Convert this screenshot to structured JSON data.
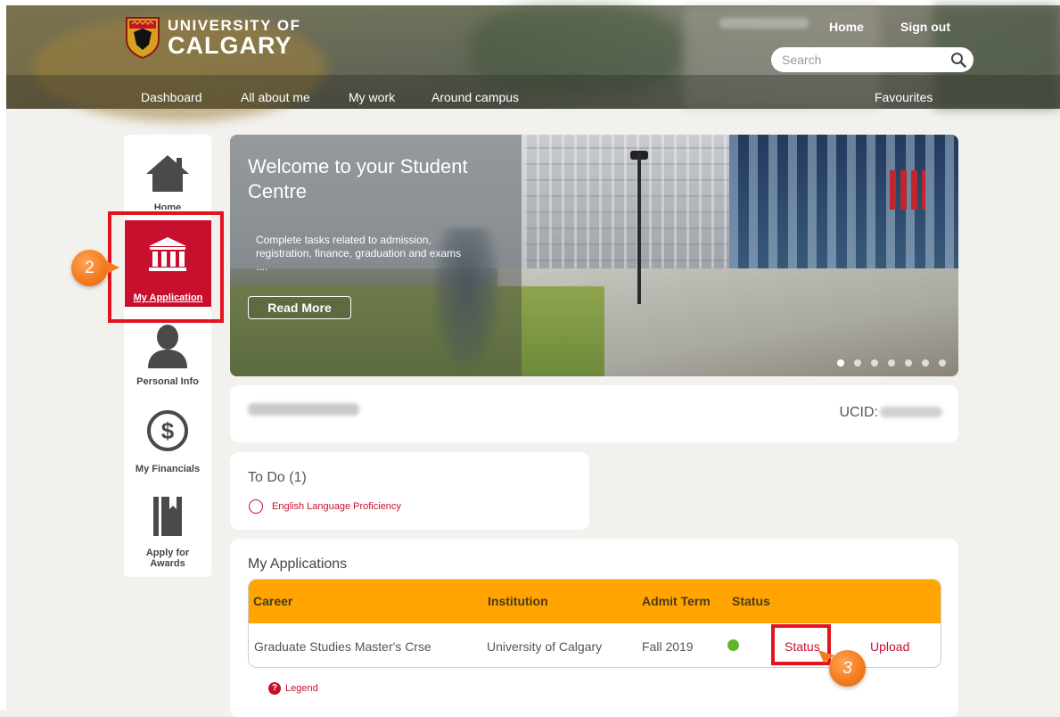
{
  "brand": {
    "logo_line1": "UNIVERSITY OF",
    "logo_line2": "CALGARY"
  },
  "header": {
    "top_links": [
      "Home",
      "Sign out"
    ],
    "search_placeholder": "Search",
    "nav": [
      "Dashboard",
      "All about me",
      "My work",
      "Around campus"
    ],
    "favourites": "Favourites"
  },
  "sidebar": {
    "items": [
      {
        "label": "Home",
        "icon": "home-icon"
      },
      {
        "label": "My Application",
        "icon": "institution-icon",
        "active": true
      },
      {
        "label": "Personal Info",
        "icon": "person-icon"
      },
      {
        "label": "My Financials",
        "icon": "dollar-icon"
      },
      {
        "label": "Apply for Awards",
        "icon": "book-icon"
      }
    ]
  },
  "annotations": {
    "step_2": "2",
    "step_3": "3",
    "highlight_color": "#e3141f",
    "badge_color": "#f47c20"
  },
  "hero": {
    "title": "Welcome to your Student Centre",
    "text": "Complete tasks related to admission, registration, finance, graduation and exams ....",
    "button": "Read More",
    "slide_count": 7,
    "active_slide": 1
  },
  "profile": {
    "ucid_label": "UCID:"
  },
  "todo": {
    "title": "To Do (1)",
    "items": [
      "English Language Proficiency"
    ]
  },
  "applications": {
    "title": "My Applications",
    "columns": [
      "Career",
      "Institution",
      "Admit Term",
      "Status"
    ],
    "rows": [
      {
        "career": "Graduate Studies Master's Crse",
        "institution": "University of Calgary",
        "admit_term": "Fall 2019",
        "status_color": "#63b32e",
        "status_link": "Status",
        "upload_link": "Upload"
      }
    ],
    "legend": "Legend"
  },
  "colors": {
    "accent_red": "#c8102e",
    "table_header": "#ffa400"
  }
}
